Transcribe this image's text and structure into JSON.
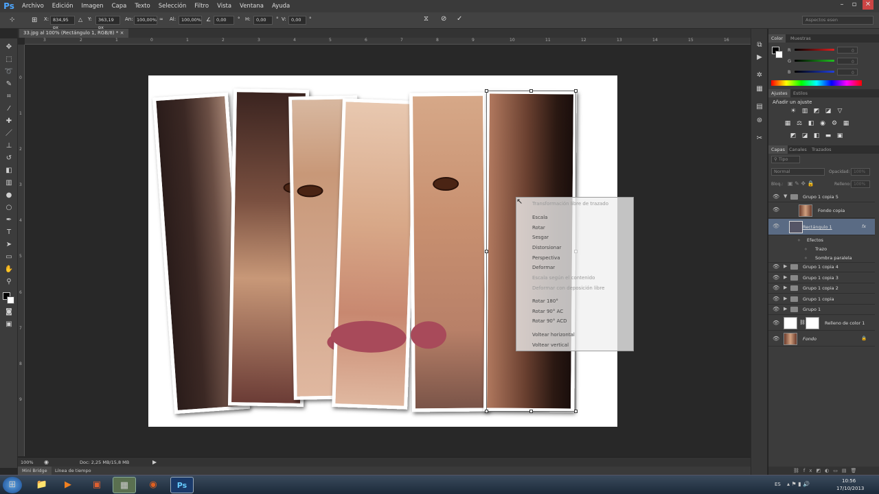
{
  "app": {
    "logo": "Ps"
  },
  "menu": [
    "Archivo",
    "Edición",
    "Imagen",
    "Capa",
    "Texto",
    "Selección",
    "Filtro",
    "Vista",
    "Ventana",
    "Ayuda"
  ],
  "options": {
    "x_label": "X:",
    "x_value": "834,95 px",
    "y_label": "Y:",
    "y_value": "363,19 px",
    "an_label": "An:",
    "an_value": "100,00%",
    "al_label": "Al:",
    "al_value": "100,00%",
    "angle_value": "0,00",
    "h_label": "H:",
    "h_value": "0,00",
    "v_label": "V:",
    "v_value": "0,00",
    "workspace": "Aspectos esen"
  },
  "document_tab": "33.jpg al 100% (Rectángulo 1, RGB/8) *",
  "ruler_h": [
    "3",
    "2",
    "1",
    "0",
    "1",
    "2",
    "3",
    "4",
    "5",
    "6",
    "7",
    "8",
    "9",
    "10",
    "11",
    "12",
    "13",
    "14",
    "15",
    "16"
  ],
  "ruler_v": [
    "0",
    "1",
    "2",
    "3",
    "4",
    "5",
    "6",
    "7",
    "8",
    "9"
  ],
  "context_menu": [
    {
      "label": "Transformación libre de trazado",
      "disabled": true
    },
    {
      "label": "Escala",
      "disabled": false
    },
    {
      "label": "Rotar",
      "disabled": false
    },
    {
      "label": "Sesgar",
      "disabled": false
    },
    {
      "label": "Distorsionar",
      "disabled": false
    },
    {
      "label": "Perspectiva",
      "disabled": false
    },
    {
      "label": "Deformar",
      "disabled": false
    },
    {
      "label": "Escala según el contenido",
      "disabled": true
    },
    {
      "label": "Deformar con deposición libre",
      "disabled": true
    },
    {
      "label": "Rotar 180°",
      "disabled": false
    },
    {
      "label": "Rotar 90° AC",
      "disabled": false
    },
    {
      "label": "Rotar 90° ACD",
      "disabled": false
    },
    {
      "label": "Voltear horizontal",
      "disabled": false
    },
    {
      "label": "Voltear vertical",
      "disabled": false
    }
  ],
  "status": {
    "zoom": "100%",
    "doc": "Doc: 2,25 MB/15,8 MB"
  },
  "bottom_tabs": [
    "Mini Bridge",
    "Línea de tiempo"
  ],
  "color_panel": {
    "tabs": [
      "Color",
      "Muestras"
    ],
    "channels": [
      "R",
      "G",
      "B"
    ],
    "values": [
      "0",
      "0",
      "0"
    ],
    "red": "#e02020",
    "green": "#20c020",
    "blue": "#2040e0"
  },
  "adjust_panel": {
    "tabs": [
      "Ajustes",
      "Estilos"
    ],
    "title": "Añadir un ajuste"
  },
  "layers_panel": {
    "tabs": [
      "Capas",
      "Canales",
      "Trazados"
    ],
    "filter": "Tipo",
    "blend": "Normal",
    "opacity_label": "Opacidad:",
    "opacity_value": "100%",
    "lock_label": "Bloq.:",
    "fill_label": "Relleno:",
    "fill_value": "100%",
    "layers": [
      "Grupo 1 copia 5",
      "Fondo copia",
      "Rectángulo 1",
      "Efectos",
      "Trazo",
      "Sombra paralela",
      "Grupo 1 copia 4",
      "Grupo 1 copia 3",
      "Grupo 1 copia 2",
      "Grupo 1 copia",
      "Grupo 1",
      "Relleno de color 1",
      "Fondo"
    ]
  },
  "taskbar": {
    "lang": "ES",
    "time": "10:56",
    "date": "17/10/2013"
  }
}
